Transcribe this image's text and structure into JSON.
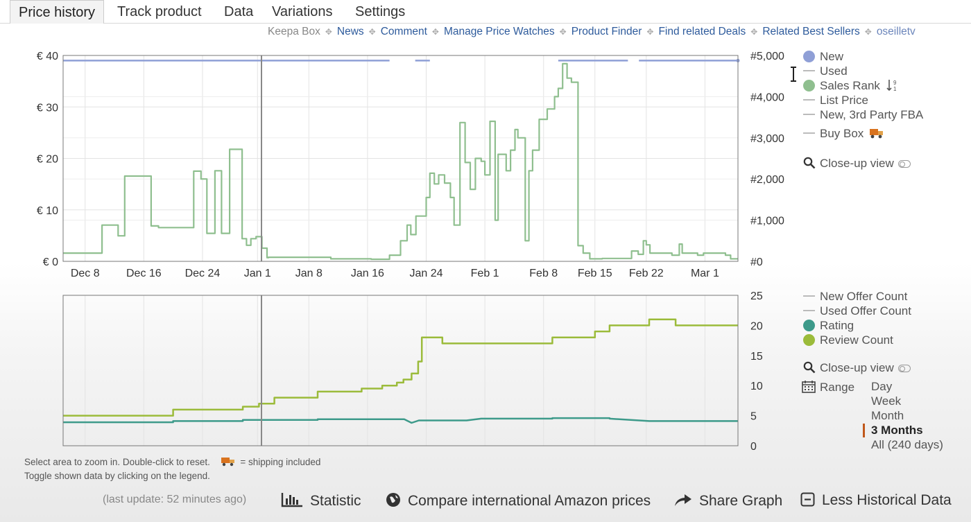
{
  "tabs": [
    "Price history",
    "Track product",
    "Data",
    "Variations",
    "Settings"
  ],
  "links": [
    "Keepa Box",
    "News",
    "Comment",
    "Manage Price Watches",
    "Product Finder",
    "Find related Deals",
    "Related Best Sellers",
    "oseilletv"
  ],
  "price_legend": {
    "new": "New",
    "used": "Used",
    "sales_rank": "Sales Rank",
    "list_price": "List Price",
    "fba": "New, 3rd Party FBA",
    "buy_box": "Buy Box",
    "closeup": "Close-up view"
  },
  "counts_legend": {
    "new_offer": "New Offer Count",
    "used_offer": "Used Offer Count",
    "rating": "Rating",
    "review": "Review Count",
    "closeup": "Close-up view",
    "range": "Range"
  },
  "range_options": [
    "Day",
    "Week",
    "Month",
    "3 Months",
    "All (240 days)"
  ],
  "range_selected": "3 Months",
  "hints": {
    "zoom": "Select area to zoom in. Double-click to reset.",
    "shipping": "= shipping included",
    "toggle": "Toggle shown data by clicking on the legend."
  },
  "bottom": {
    "last_update": "(last update: 52 minutes ago)",
    "statistic": "Statistic",
    "compare": "Compare international Amazon prices",
    "share": "Share Graph",
    "less": "Less Historical Data"
  },
  "colors": {
    "new": "#8f9fd6",
    "sales_rank": "#8fbf8f",
    "rating": "#3d9a8a",
    "review": "#9bbb3a",
    "link": "#2e5b9c",
    "selected_range": "#c0581b"
  },
  "chart_data": [
    {
      "type": "line",
      "x_ticks": [
        "Dec 8",
        "Dec 16",
        "Dec 24",
        "Jan 1",
        "Jan 8",
        "Jan 16",
        "Jan 24",
        "Feb 1",
        "Feb 8",
        "Feb 15",
        "Feb 22",
        "Mar 1"
      ],
      "y_left_ticks": [
        "€ 0",
        "€ 10",
        "€ 20",
        "€ 30",
        "€ 40"
      ],
      "y_right_ticks": [
        "#0",
        "#1,000",
        "#2,000",
        "#3,000",
        "#4,000",
        "#5,000"
      ],
      "ylim_left": [
        0,
        40
      ],
      "ylim_right": [
        0,
        5000
      ],
      "x_range_days": [
        0,
        92
      ],
      "series": [
        {
          "name": "New",
          "axis": "left",
          "points": [
            [
              0,
              39
            ],
            [
              44.5,
              39
            ],
            [
              48,
              39
            ],
            [
              50,
              39
            ],
            [
              67.5,
              39
            ],
            [
              77,
              39
            ],
            [
              78.5,
              39
            ],
            [
              92,
              39
            ]
          ]
        },
        {
          "name": "Sales Rank",
          "axis": "right",
          "points": [
            [
              0,
              200
            ],
            [
              5.3,
              200
            ],
            [
              5.3,
              880
            ],
            [
              7.5,
              880
            ],
            [
              7.5,
              620
            ],
            [
              8.4,
              620
            ],
            [
              8.4,
              2070
            ],
            [
              12,
              2070
            ],
            [
              12,
              860
            ],
            [
              13,
              860
            ],
            [
              13,
              820
            ],
            [
              17.8,
              820
            ],
            [
              17.8,
              2190
            ],
            [
              18.8,
              2190
            ],
            [
              18.8,
              2000
            ],
            [
              19.6,
              2000
            ],
            [
              19.6,
              680
            ],
            [
              20.7,
              680
            ],
            [
              20.7,
              2200
            ],
            [
              21.6,
              2200
            ],
            [
              21.6,
              680
            ],
            [
              22.7,
              680
            ],
            [
              22.7,
              2720
            ],
            [
              24.4,
              2720
            ],
            [
              24.4,
              550
            ],
            [
              25,
              550
            ],
            [
              25,
              390
            ],
            [
              25.6,
              390
            ],
            [
              25.6,
              550
            ],
            [
              26.3,
              550
            ],
            [
              26.3,
              600
            ],
            [
              27.1,
              600
            ],
            [
              27.1,
              320
            ],
            [
              27.8,
              320
            ],
            [
              27.8,
              90
            ],
            [
              28,
              90
            ],
            [
              28,
              100
            ],
            [
              32,
              100
            ],
            [
              36.5,
              100
            ],
            [
              36.5,
              60
            ],
            [
              42,
              60
            ],
            [
              42,
              50
            ],
            [
              44.5,
              50
            ],
            [
              44.5,
              150
            ],
            [
              46,
              150
            ],
            [
              46,
              500
            ],
            [
              46.9,
              500
            ],
            [
              46.9,
              880
            ],
            [
              47.4,
              880
            ],
            [
              47.4,
              650
            ],
            [
              48.1,
              650
            ],
            [
              48.1,
              1100
            ],
            [
              49.5,
              1100
            ],
            [
              49.5,
              1550
            ],
            [
              50,
              1550
            ],
            [
              50,
              2140
            ],
            [
              50.6,
              2140
            ],
            [
              50.6,
              1880
            ],
            [
              51.2,
              1880
            ],
            [
              51.2,
              2100
            ],
            [
              52,
              2100
            ],
            [
              52,
              1900
            ],
            [
              52.8,
              1900
            ],
            [
              52.8,
              1550
            ],
            [
              53.3,
              1550
            ],
            [
              53.3,
              880
            ],
            [
              54.1,
              880
            ],
            [
              54.1,
              3370
            ],
            [
              54.8,
              3370
            ],
            [
              54.8,
              2400
            ],
            [
              55.5,
              2400
            ],
            [
              55.5,
              1750
            ],
            [
              56.2,
              1750
            ],
            [
              56.2,
              2500
            ],
            [
              57,
              2500
            ],
            [
              57,
              2430
            ],
            [
              57.5,
              2430
            ],
            [
              57.5,
              2100
            ],
            [
              58.2,
              2100
            ],
            [
              58.2,
              3400
            ],
            [
              58.9,
              3400
            ],
            [
              58.9,
              1000
            ],
            [
              59.3,
              1000
            ],
            [
              59.3,
              2600
            ],
            [
              60.4,
              2600
            ],
            [
              60.4,
              2200
            ],
            [
              61,
              2200
            ],
            [
              61,
              2700
            ],
            [
              61.6,
              2700
            ],
            [
              61.6,
              3200
            ],
            [
              62,
              3200
            ],
            [
              62,
              3000
            ],
            [
              63,
              3000
            ],
            [
              63,
              500
            ],
            [
              63.5,
              500
            ],
            [
              63.5,
              2200
            ],
            [
              64,
              2200
            ],
            [
              64,
              2700
            ],
            [
              64.9,
              2700
            ],
            [
              64.9,
              3450
            ],
            [
              66,
              3450
            ],
            [
              66,
              3700
            ],
            [
              67,
              3700
            ],
            [
              67,
              4000
            ],
            [
              67.5,
              4000
            ],
            [
              67.5,
              4200
            ],
            [
              68.1,
              4200
            ],
            [
              68.1,
              4800
            ],
            [
              68.7,
              4800
            ],
            [
              68.7,
              4450
            ],
            [
              69.3,
              4450
            ],
            [
              69.3,
              4350
            ],
            [
              70.2,
              4350
            ],
            [
              70.2,
              380
            ],
            [
              70.9,
              380
            ],
            [
              70.9,
              200
            ],
            [
              71.8,
              200
            ],
            [
              71.8,
              60
            ],
            [
              73.5,
              60
            ],
            [
              73.5,
              70
            ],
            [
              77.5,
              70
            ],
            [
              77.5,
              250
            ],
            [
              78.4,
              250
            ],
            [
              78.4,
              170
            ],
            [
              79.1,
              170
            ],
            [
              79.1,
              500
            ],
            [
              79.5,
              500
            ],
            [
              79.5,
              400
            ],
            [
              80,
              400
            ],
            [
              80,
              200
            ],
            [
              83,
              200
            ],
            [
              83,
              150
            ],
            [
              84,
              150
            ],
            [
              84,
              420
            ],
            [
              84.4,
              420
            ],
            [
              84.4,
              200
            ],
            [
              86.5,
              200
            ],
            [
              86.5,
              150
            ],
            [
              87.3,
              150
            ],
            [
              87.3,
              200
            ],
            [
              90.3,
              200
            ],
            [
              90.3,
              150
            ],
            [
              91,
              150
            ],
            [
              91,
              60
            ],
            [
              92,
              60
            ]
          ]
        }
      ]
    },
    {
      "type": "line",
      "x_range_days": [
        0,
        92
      ],
      "y_ticks": [
        "0",
        "5",
        "10",
        "15",
        "20",
        "25"
      ],
      "ylim": [
        0,
        25
      ],
      "series": [
        {
          "name": "Review Count",
          "points": [
            [
              0,
              5
            ],
            [
              15,
              5
            ],
            [
              15,
              6
            ],
            [
              24.5,
              6
            ],
            [
              24.5,
              6.5
            ],
            [
              26.7,
              6.5
            ],
            [
              26.7,
              7
            ],
            [
              28.8,
              7
            ],
            [
              28.8,
              8
            ],
            [
              34.7,
              8
            ],
            [
              34.7,
              9
            ],
            [
              40.7,
              9
            ],
            [
              40.7,
              9.5
            ],
            [
              43.5,
              9.5
            ],
            [
              43.5,
              10
            ],
            [
              45.5,
              10
            ],
            [
              45.5,
              10.5
            ],
            [
              46.4,
              10.5
            ],
            [
              46.4,
              11
            ],
            [
              47.5,
              11
            ],
            [
              47.5,
              12
            ],
            [
              48.4,
              12
            ],
            [
              48.4,
              14
            ],
            [
              48.9,
              14
            ],
            [
              48.9,
              18
            ],
            [
              51.7,
              18
            ],
            [
              51.7,
              17
            ],
            [
              66.7,
              17
            ],
            [
              66.7,
              18
            ],
            [
              72.5,
              18
            ],
            [
              72.5,
              19
            ],
            [
              74.5,
              19
            ],
            [
              74.5,
              20
            ],
            [
              79.9,
              20
            ],
            [
              79.9,
              21
            ],
            [
              83.5,
              21
            ],
            [
              83.5,
              20
            ],
            [
              92,
              20
            ]
          ]
        },
        {
          "name": "Rating",
          "points": [
            [
              0,
              3.9
            ],
            [
              15,
              3.9
            ],
            [
              15,
              4.1
            ],
            [
              24.5,
              4.1
            ],
            [
              24.5,
              4.3
            ],
            [
              34.7,
              4.3
            ],
            [
              34.7,
              4.4
            ],
            [
              46.5,
              4.4
            ],
            [
              47.5,
              3.8
            ],
            [
              48.5,
              4.2
            ],
            [
              55,
              4.2
            ],
            [
              57,
              4.5
            ],
            [
              66.7,
              4.5
            ],
            [
              66.7,
              4.6
            ],
            [
              74.5,
              4.6
            ],
            [
              74.5,
              4.5
            ],
            [
              79.9,
              4.1
            ],
            [
              92,
              4.1
            ]
          ]
        }
      ]
    }
  ]
}
